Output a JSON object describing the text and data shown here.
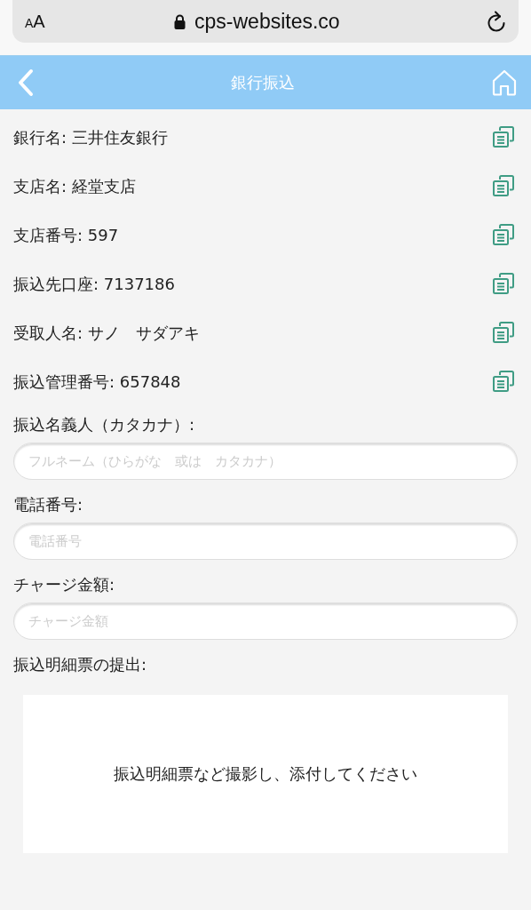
{
  "browser_bar": {
    "text_size": [
      "A",
      "A"
    ],
    "url": "cps-websites.co"
  },
  "header": {
    "title": "銀行振込"
  },
  "info_rows": [
    {
      "text": "銀行名: 三井住友銀行"
    },
    {
      "text": "支店名: 経堂支店"
    },
    {
      "text": "支店番号: 597"
    },
    {
      "text": "振込先口座: 7137186"
    },
    {
      "text": "受取人名: サノ　サダアキ"
    },
    {
      "text": "振込管理番号: 657848"
    }
  ],
  "fields": [
    {
      "label": "振込名義人（カタカナ）:",
      "placeholder": "フルネーム（ひらがな　或は　カタカナ）"
    },
    {
      "label": "電話番号:",
      "placeholder": "電話番号"
    },
    {
      "label": "チャージ金額:",
      "placeholder": "チャージ金額"
    }
  ],
  "upload": {
    "label": "振込明細票の提出:",
    "prompt": "振込明細票など撮影し、添付してください"
  }
}
